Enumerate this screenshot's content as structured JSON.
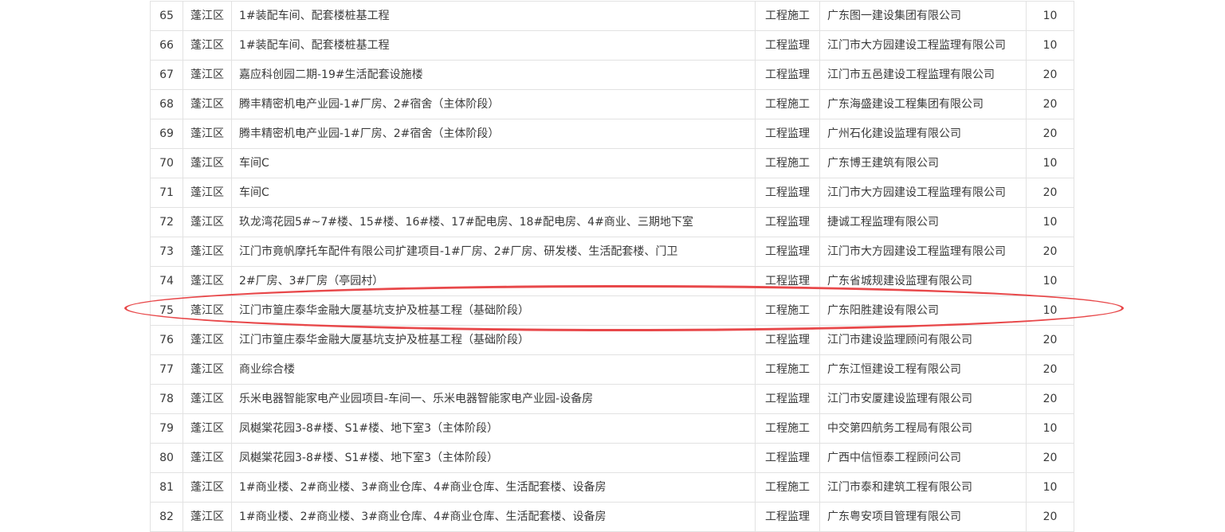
{
  "table": {
    "rows": [
      {
        "no": "65",
        "district": "蓬江区",
        "project": "1#装配车间、配套楼桩基工程",
        "type": "工程施工",
        "company": "广东图一建设集团有限公司",
        "score": "10"
      },
      {
        "no": "66",
        "district": "蓬江区",
        "project": "1#装配车间、配套楼桩基工程",
        "type": "工程监理",
        "company": "江门市大方园建设工程监理有限公司",
        "score": "10"
      },
      {
        "no": "67",
        "district": "蓬江区",
        "project": "嘉应科创园二期-19#生活配套设施楼",
        "type": "工程监理",
        "company": "江门市五邑建设工程监理有限公司",
        "score": "20"
      },
      {
        "no": "68",
        "district": "蓬江区",
        "project": "腾丰精密机电产业园-1#厂房、2#宿舍（主体阶段）",
        "type": "工程施工",
        "company": "广东海盛建设工程集团有限公司",
        "score": "20"
      },
      {
        "no": "69",
        "district": "蓬江区",
        "project": "腾丰精密机电产业园-1#厂房、2#宿舍（主体阶段）",
        "type": "工程监理",
        "company": "广州石化建设监理有限公司",
        "score": "20"
      },
      {
        "no": "70",
        "district": "蓬江区",
        "project": "车间C",
        "type": "工程施工",
        "company": "广东博王建筑有限公司",
        "score": "10"
      },
      {
        "no": "71",
        "district": "蓬江区",
        "project": "车间C",
        "type": "工程监理",
        "company": "江门市大方园建设工程监理有限公司",
        "score": "20"
      },
      {
        "no": "72",
        "district": "蓬江区",
        "project": "玖龙湾花园5#~7#楼、15#楼、16#楼、17#配电房、18#配电房、4#商业、三期地下室",
        "type": "工程监理",
        "company": "捷诚工程监理有限公司",
        "score": "10"
      },
      {
        "no": "73",
        "district": "蓬江区",
        "project": "江门市竟帆摩托车配件有限公司扩建项目-1#厂房、2#厂房、研发楼、生活配套楼、门卫",
        "type": "工程监理",
        "company": "江门市大方园建设工程监理有限公司",
        "score": "20"
      },
      {
        "no": "74",
        "district": "蓬江区",
        "project": "2#厂房、3#厂房（亭园村）",
        "type": "工程监理",
        "company": "广东省城规建设监理有限公司",
        "score": "10"
      },
      {
        "no": "75",
        "district": "蓬江区",
        "project": "江门市篁庄泰华金融大厦基坑支护及桩基工程（基础阶段）",
        "type": "工程施工",
        "company": "广东阳胜建设有限公司",
        "score": "10"
      },
      {
        "no": "76",
        "district": "蓬江区",
        "project": "江门市篁庄泰华金融大厦基坑支护及桩基工程（基础阶段）",
        "type": "工程监理",
        "company": "江门市建设监理顾问有限公司",
        "score": "20"
      },
      {
        "no": "77",
        "district": "蓬江区",
        "project": "商业综合楼",
        "type": "工程施工",
        "company": "广东江恒建设工程有限公司",
        "score": "20"
      },
      {
        "no": "78",
        "district": "蓬江区",
        "project": "乐米电器智能家电产业园项目-车间一、乐米电器智能家电产业园-设备房",
        "type": "工程监理",
        "company": "江门市安厦建设监理有限公司",
        "score": "20"
      },
      {
        "no": "79",
        "district": "蓬江区",
        "project": "凤樾棠花园3-8#楼、S1#楼、地下室3（主体阶段）",
        "type": "工程施工",
        "company": "中交第四航务工程局有限公司",
        "score": "10"
      },
      {
        "no": "80",
        "district": "蓬江区",
        "project": "凤樾棠花园3-8#楼、S1#楼、地下室3（主体阶段）",
        "type": "工程监理",
        "company": "广西中信恒泰工程顾问公司",
        "score": "20"
      },
      {
        "no": "81",
        "district": "蓬江区",
        "project": "1#商业楼、2#商业楼、3#商业仓库、4#商业仓库、生活配套楼、设备房",
        "type": "工程施工",
        "company": "江门市泰和建筑工程有限公司",
        "score": "10"
      },
      {
        "no": "82",
        "district": "蓬江区",
        "project": "1#商业楼、2#商业楼、3#商业仓库、4#商业仓库、生活配套楼、设备房",
        "type": "工程监理",
        "company": "广东粤安项目管理有限公司",
        "score": "20"
      }
    ]
  },
  "highlight": {
    "color": "#e8484a",
    "row_no": "75"
  }
}
